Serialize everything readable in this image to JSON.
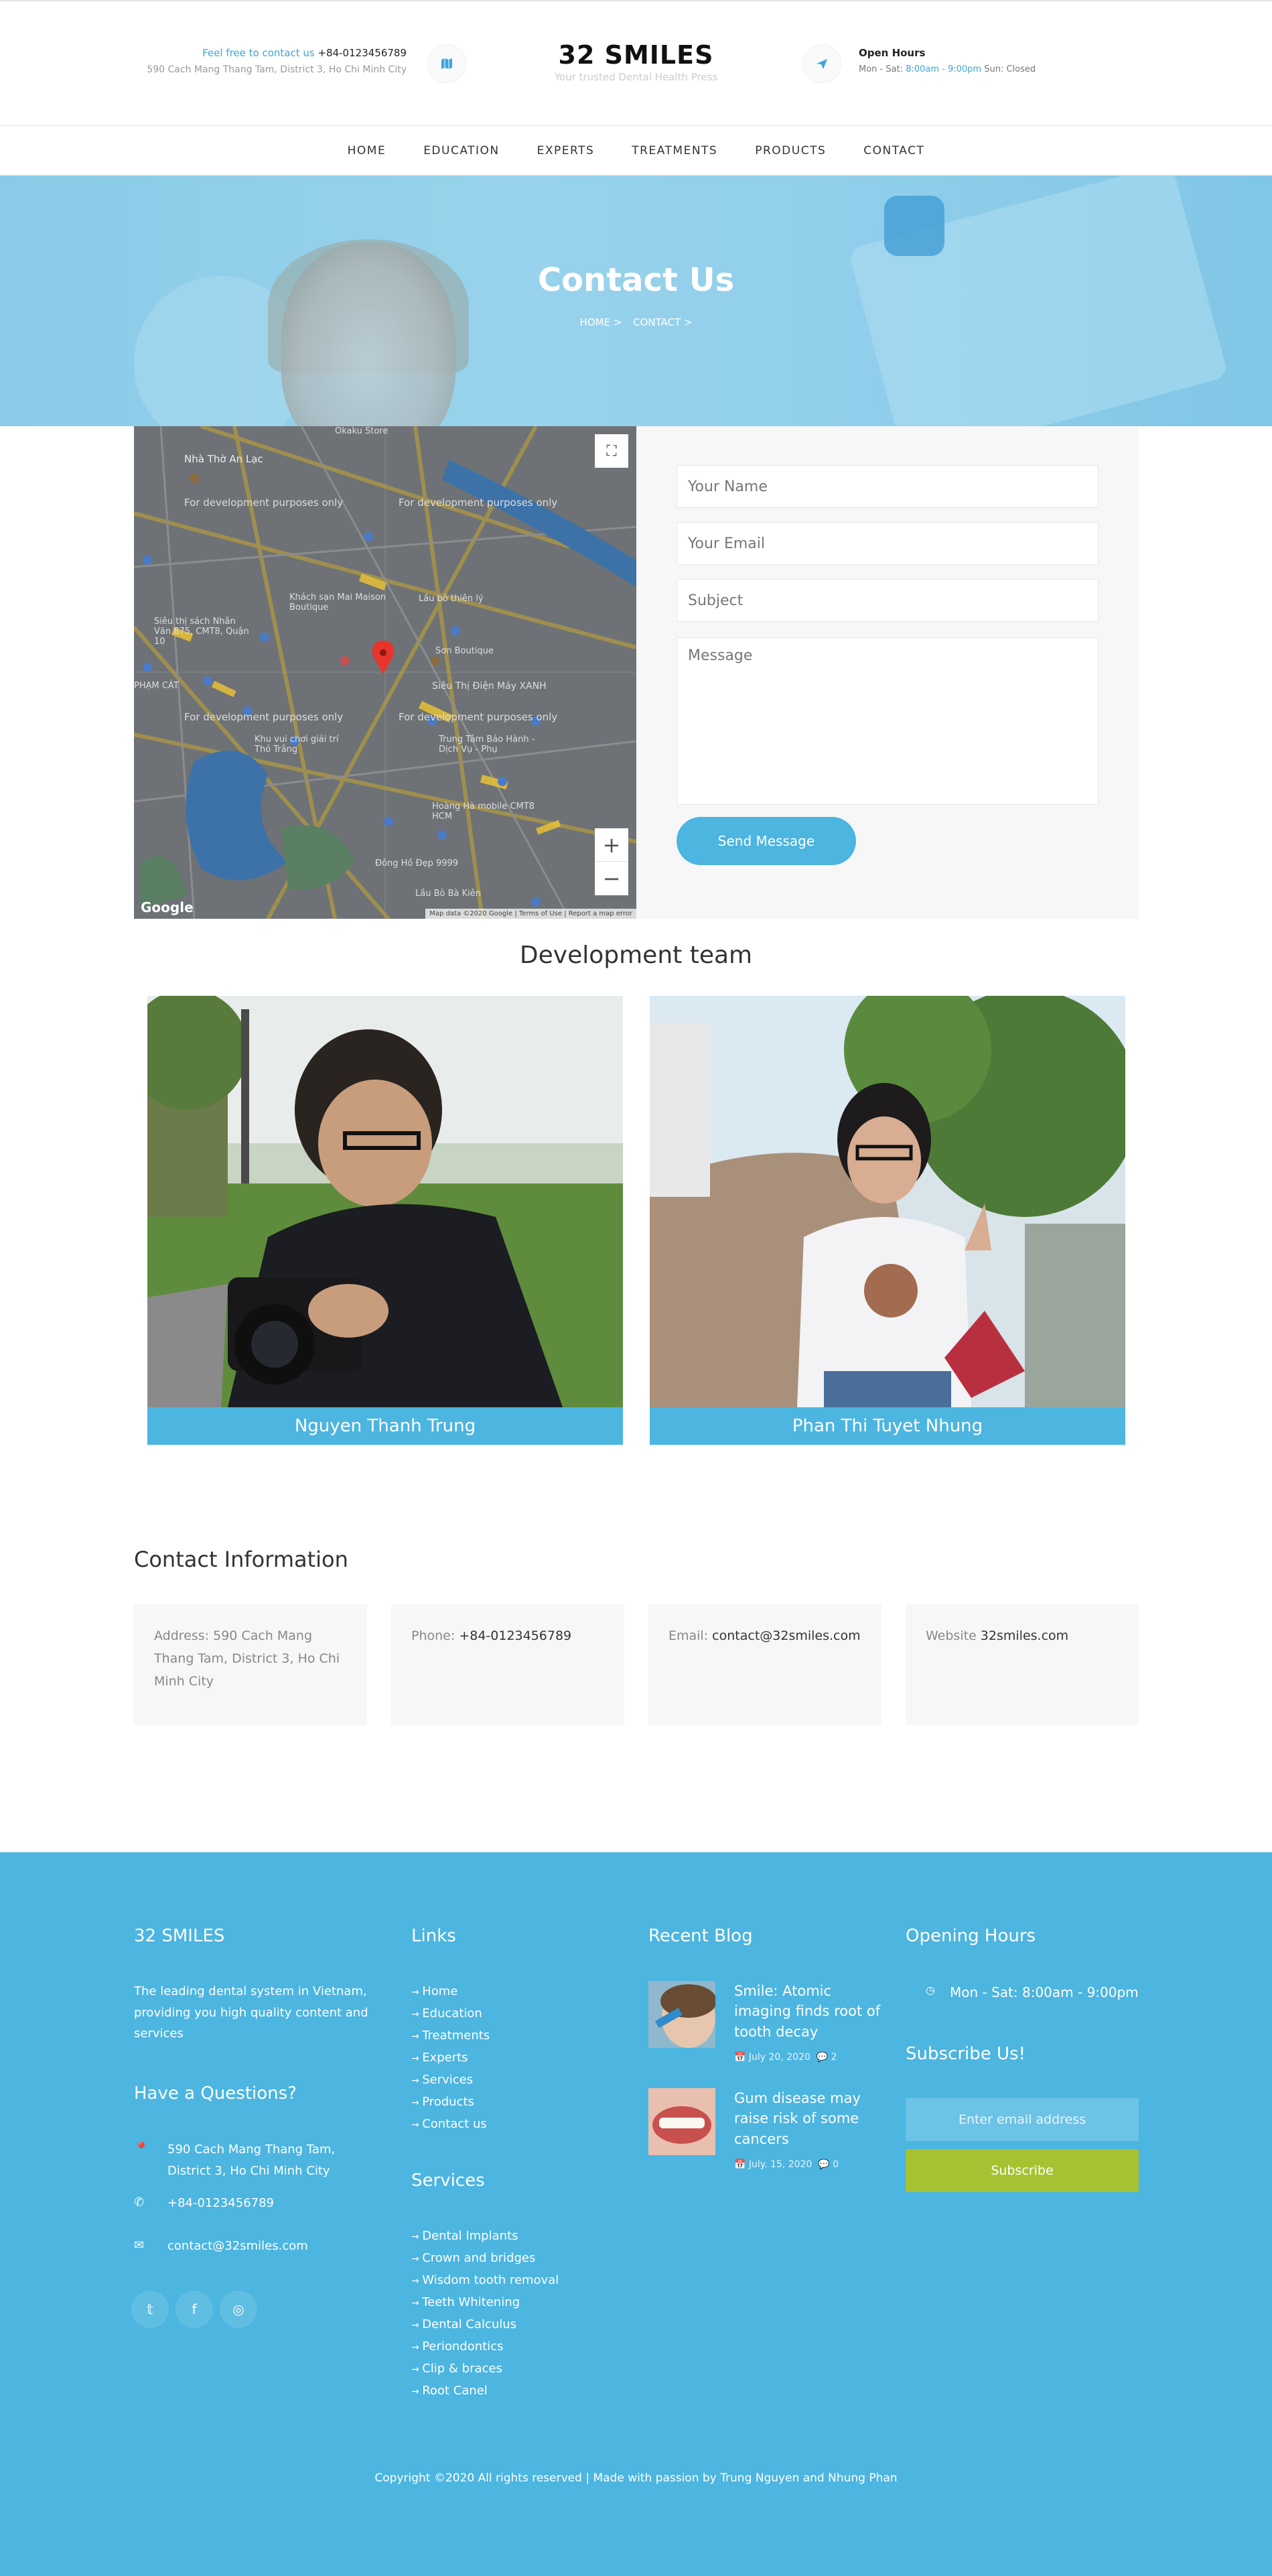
{
  "header": {
    "contact_prefix": "Feel free to contact us",
    "phone": "+84-0123456789",
    "address": "590 Cach Mang Thang Tam, District 3, Ho Chi Minh City",
    "brand": "32 SMILES",
    "tagline": "Your trusted Dental Health Press",
    "hours_title": "Open Hours",
    "hours_prefix": "Mon - Sat:",
    "hours_time": "8:00am - 9:00pm",
    "hours_suffix": "Sun: Closed"
  },
  "nav": [
    "HOME",
    "EDUCATION",
    "EXPERTS",
    "TREATMENTS",
    "PRODUCTS",
    "CONTACT"
  ],
  "hero": {
    "title": "Contact Us",
    "crumb_home": "HOME >",
    "crumb_current": "CONTACT >"
  },
  "map": {
    "dev_label": "For development purposes only",
    "google": "Google",
    "footer": "Map data ©2020 Google | Terms of Use | Report a map error",
    "places": [
      "Nhà Thờ An Lạc",
      "Siêu thị sách Nhân Văn 875, CMT8, Quận 10",
      "Khách sạn Mai Maison Boutique",
      "Lầu bò thiên lý",
      "Siêu Thị Điện Máy XANH",
      "Hoàng Hà mobile CMT8 HCM",
      "Trung Tâm Bảo Hành - Dịch Vụ - Phụ",
      "Khu vui chơi giải trí Thỏ Trắng",
      "Đông Hồ Đẹp 9999",
      "Lầu Bò Bà Kiên",
      "Sơn Boutique",
      "Okaku Store",
      "PHẠM CÁT"
    ]
  },
  "form": {
    "name_placeholder": "Your Name",
    "email_placeholder": "Your Email",
    "subject_placeholder": "Subject",
    "message_placeholder": "Message",
    "send_label": "Send Message"
  },
  "team": {
    "title": "Development team",
    "members": [
      {
        "name": "Nguyen Thanh Trung"
      },
      {
        "name": "Phan Thi Tuyet Nhung"
      }
    ]
  },
  "contact_info": {
    "title": "Contact Information",
    "address_label": "Address:",
    "address": "590 Cach Mang Thang Tam, District 3, Ho Chi Minh City",
    "phone_label": "Phone:",
    "phone": "+84-0123456789",
    "email_label": "Email:",
    "email": "contact@32smiles.com",
    "website_label": "Website",
    "website": "32smiles.com"
  },
  "footer": {
    "brand": "32 SMILES",
    "about": "The leading dental system in Vietnam, providing you high quality content and services",
    "questions_title": "Have a Questions?",
    "address": "590 Cach Mang Thang Tam, District 3, Ho Chi Minh City",
    "phone": "+84-0123456789",
    "email": "contact@32smiles.com",
    "links_title": "Links",
    "links": [
      "Home",
      "Education",
      "Treatments",
      "Experts",
      "Services",
      "Products",
      "Contact us"
    ],
    "services_title": "Services",
    "services": [
      "Dental Implants",
      "Crown and bridges",
      "Wisdom tooth removal",
      "Teeth Whitening",
      "Dental Calculus",
      "Periondontics",
      "Clip & braces",
      "Root Canel"
    ],
    "blog_title": "Recent Blog",
    "blogs": [
      {
        "title": "Smile: Atomic imaging finds root of tooth decay",
        "date": "July 20, 2020",
        "comments": "2"
      },
      {
        "title": "Gum disease may raise risk of some cancers",
        "date": "July. 15, 2020",
        "comments": "0"
      }
    ],
    "hours_title": "Opening Hours",
    "hours": "Mon - Sat: 8:00am - 9:00pm",
    "subscribe_title": "Subscribe Us!",
    "email_placeholder": "Enter email address",
    "subscribe_label": "Subscribe",
    "copyright": "Copyright ©2020 All rights reserved | Made with passion by Trung Nguyen and Nhung Phan"
  },
  "colors": {
    "accent": "#4cb5e0",
    "subscribe": "#a6c232",
    "hero": "#a7d8ee"
  }
}
